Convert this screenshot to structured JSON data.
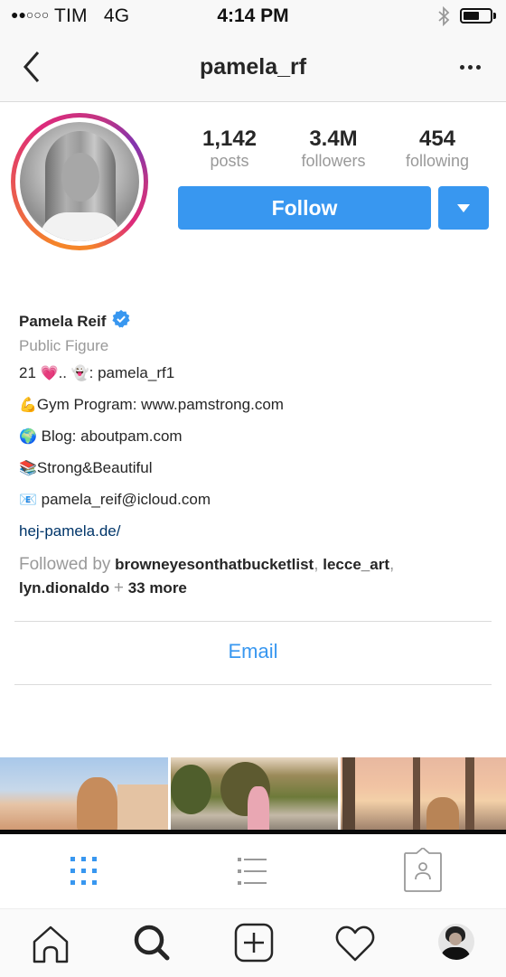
{
  "status_bar": {
    "signal_dots": "●●○○○",
    "carrier": "TIM",
    "network": "4G",
    "time": "4:14 PM",
    "bluetooth_icon": "bluetooth-icon",
    "battery_level": 0.6
  },
  "navbar": {
    "back_icon": "chevron-left-icon",
    "title": "pamela_rf",
    "more_icon": "more-horizontal-icon"
  },
  "profile": {
    "stats": [
      {
        "value": "1,142",
        "label": "posts"
      },
      {
        "value": "3.4M",
        "label": "followers"
      },
      {
        "value": "454",
        "label": "following"
      }
    ],
    "follow_label": "Follow",
    "dropdown_icon": "caret-down-icon",
    "name": "Pamela Reif",
    "verified": true,
    "category": "Public Figure",
    "bio_lines": [
      {
        "emoji_a": "21 ",
        "emoji": "💗",
        "text": ".. ",
        "emoji2": "👻",
        "text2": ": pamela_rf1"
      },
      {
        "emoji": "💪",
        "text": "Gym Program: www.pamstrong.com"
      },
      {
        "emoji": "🌍",
        "text": " Blog: aboutpam.com"
      },
      {
        "emoji": "📚",
        "text": "Strong&Beautiful"
      },
      {
        "emoji": "📧",
        "text": " pamela_reif@icloud.com"
      }
    ],
    "website": "hej-pamela.de/",
    "followed_by": {
      "prefix": "Followed by",
      "users": [
        "browneyesonthatbucketlist",
        "lecce_art",
        "lyn.dionaldo"
      ],
      "plus": "+",
      "more": "33 more"
    },
    "email_label": "Email"
  },
  "view_tabs": [
    {
      "name": "grid",
      "icon": "grid-icon",
      "active": true
    },
    {
      "name": "list",
      "icon": "list-icon",
      "active": false
    },
    {
      "name": "tagged",
      "icon": "tagged-person-icon",
      "active": false
    }
  ],
  "bottom_nav": [
    {
      "name": "home",
      "icon": "home-icon"
    },
    {
      "name": "search",
      "icon": "search-icon"
    },
    {
      "name": "new-post",
      "icon": "plus-square-icon"
    },
    {
      "name": "activity",
      "icon": "heart-icon"
    },
    {
      "name": "profile",
      "icon": "avatar"
    }
  ],
  "colors": {
    "accent": "#3897f0",
    "link": "#003569",
    "muted": "#999999",
    "text": "#262626"
  }
}
